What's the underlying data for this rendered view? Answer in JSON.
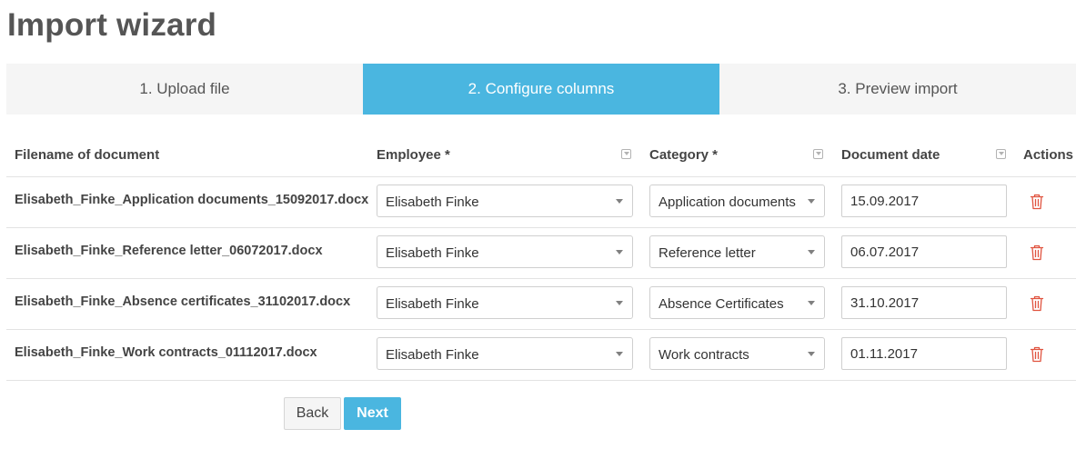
{
  "page": {
    "title": "Import wizard"
  },
  "steps": [
    {
      "label": "1. Upload file",
      "active": false
    },
    {
      "label": "2. Configure columns",
      "active": true
    },
    {
      "label": "3. Preview import",
      "active": false
    }
  ],
  "table": {
    "headers": {
      "filename": "Filename of document",
      "employee": "Employee *",
      "category": "Category *",
      "document_date": "Document date",
      "actions": "Actions"
    },
    "rows": [
      {
        "filename": "Elisabeth_Finke_Application documents_15092017.docx",
        "employee": "Elisabeth Finke",
        "category": "Application documents",
        "date": "15.09.2017"
      },
      {
        "filename": "Elisabeth_Finke_Reference letter_06072017.docx",
        "employee": "Elisabeth Finke",
        "category": "Reference letter",
        "date": "06.07.2017"
      },
      {
        "filename": "Elisabeth_Finke_Absence certificates_31102017.docx",
        "employee": "Elisabeth Finke",
        "category": "Absence Certificates",
        "date": "31.10.2017"
      },
      {
        "filename": "Elisabeth_Finke_Work contracts_01112017.docx",
        "employee": "Elisabeth Finke",
        "category": "Work contracts",
        "date": "01.11.2017"
      }
    ]
  },
  "buttons": {
    "back": "Back",
    "next": "Next"
  },
  "icons": {
    "filter": "filter-dropdown-icon",
    "delete": "trash-icon",
    "select": "caret-down-icon"
  },
  "colors": {
    "accent": "#4ab6e0",
    "delete": "#e0533f",
    "step_bg": "#f5f5f5"
  }
}
